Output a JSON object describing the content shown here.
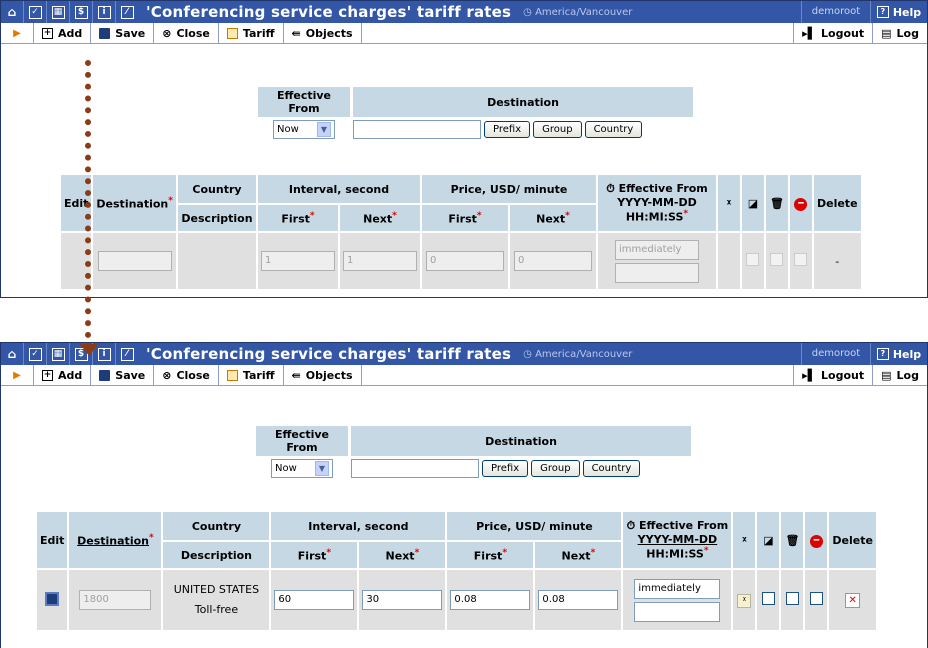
{
  "titlebar": {
    "title": "'Conferencing service charges' tariff rates",
    "timezone": "America/Vancouver",
    "user": "demoroot",
    "help": "Help"
  },
  "toolbar": {
    "add": "Add",
    "save": "Save",
    "close": "Close",
    "tariff": "Tariff",
    "objects": "Objects",
    "logout": "Logout",
    "log": "Log"
  },
  "filter": {
    "effective_from_header": "Effective From",
    "destination_header": "Destination",
    "effective_from_value": "Now",
    "destination_value": "",
    "prefix_button": "Prefix",
    "group_button": "Group",
    "country_button": "Country"
  },
  "grid": {
    "edit": "Edit",
    "destination": "Destination",
    "country": "Country",
    "description": "Description",
    "interval": "Interval, second",
    "price": "Price, USD/ minute",
    "first": "First",
    "next": "Next",
    "effective_from": "Effective From",
    "date_format": "YYYY-MM-DD",
    "time_format": "HH:MI:SS",
    "delete": "Delete",
    "dash": "-"
  },
  "row_new": {
    "destination": "",
    "interval_first": "1",
    "interval_next": "1",
    "price_first": "0",
    "price_next": "0",
    "effective": "immediately"
  },
  "row_edit": {
    "destination": "1800",
    "country": "UNITED STATES",
    "description": "Toll-free",
    "interval_first": "60",
    "interval_next": "30",
    "price_first": "0.08",
    "price_next": "0.08",
    "effective": "immediately"
  },
  "colors": {
    "titlebar": "#3456a6",
    "header_cell": "#c5d8e4",
    "row_bg": "#e0e0e0",
    "callout_arrow": "#8b3c16"
  }
}
